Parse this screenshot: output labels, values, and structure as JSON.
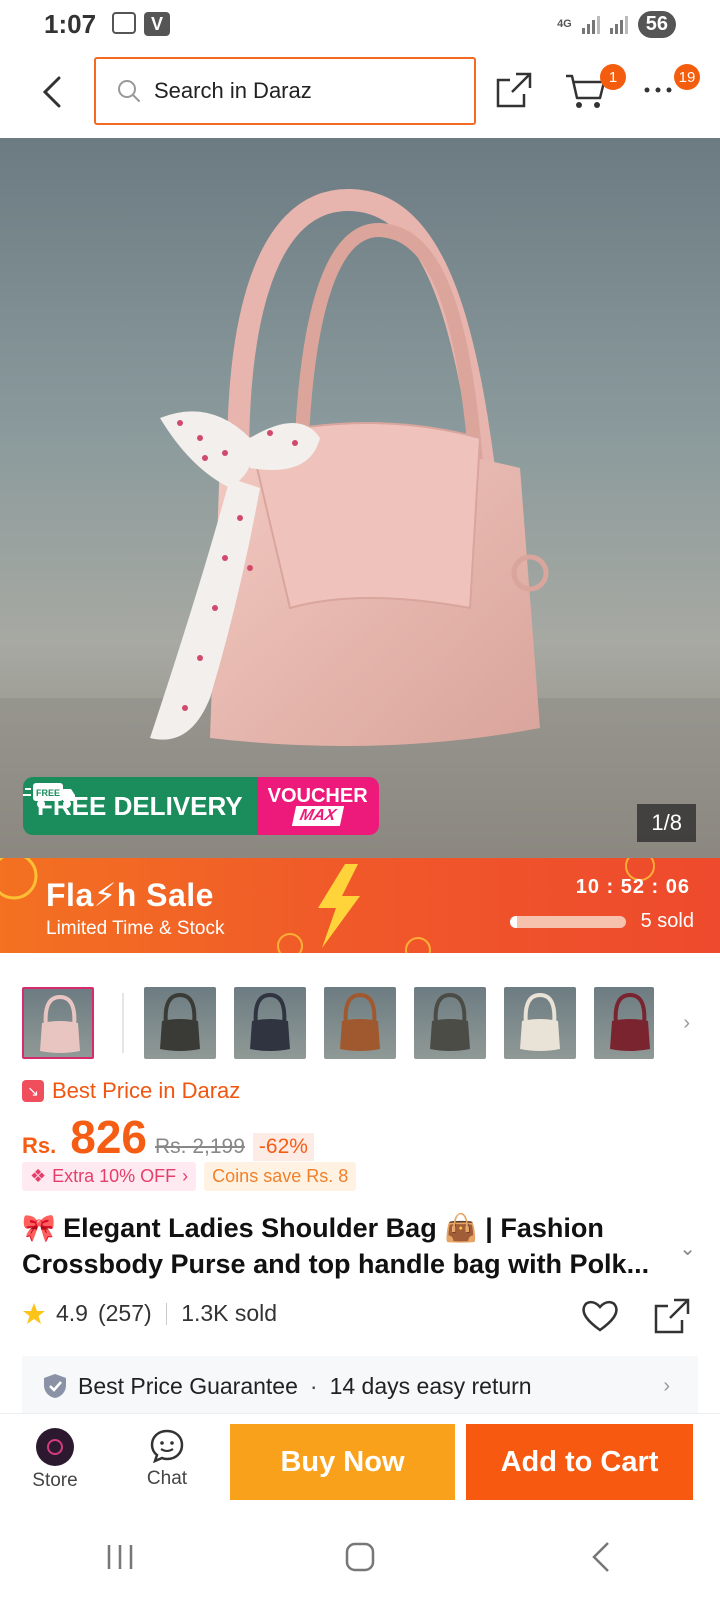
{
  "status_bar": {
    "time": "1:07",
    "network": "4G",
    "battery": "56",
    "signal_level": 0.6
  },
  "header": {
    "search_placeholder": "Search in Daraz",
    "cart_badge": "1",
    "more_badge": "19",
    "icons": [
      "back-arrow-icon",
      "search-icon",
      "share-icon",
      "cart-icon",
      "more-icon"
    ]
  },
  "hero": {
    "free_delivery_badge": "FREE",
    "free_delivery_label": "FREE DELIVERY",
    "voucher_label": "VOUCHER",
    "voucher_max": "MAX",
    "image_counter": "1/8"
  },
  "flash_sale": {
    "title": "Fla⚡h Sale",
    "subtitle": "Limited Time & Stock",
    "timer": "10 : 52 : 06",
    "sold": "5 sold",
    "sold_progress": 0.06
  },
  "thumbnails": {
    "colors": [
      "#e8c5c0",
      "#3a3a36",
      "#2f3440",
      "#a0582f",
      "#4a4c45",
      "#e9e2d7",
      "#7a2430"
    ]
  },
  "price": {
    "best_price_label": "Best Price in Daraz",
    "currency": "Rs.",
    "current": "826",
    "original": "Rs. 2,199",
    "discount": "-62%",
    "extra_off": "Extra 10% OFF",
    "coins_save": "Coins save Rs. 8"
  },
  "product": {
    "title": "🎀 Elegant Ladies Shoulder Bag 👜 | Fashion Crossbody Purse and top handle bag with Polk...",
    "rating": "4.9",
    "reviews": "(257)",
    "sold": "1.3K sold"
  },
  "guarantee": {
    "item1": "Best Price Guarantee",
    "separator": "·",
    "item2": "14 days easy return"
  },
  "bottom_bar": {
    "store_label": "Store",
    "chat_label": "Chat",
    "buy_now_label": "Buy Now",
    "add_to_cart_label": "Add to Cart"
  },
  "colors": {
    "accent": "#f6590f",
    "buy_now": "#f9a11b",
    "flash_sale": "#f0582a",
    "free_delivery": "#1b8c5c",
    "voucher": "#ee1a7b"
  }
}
